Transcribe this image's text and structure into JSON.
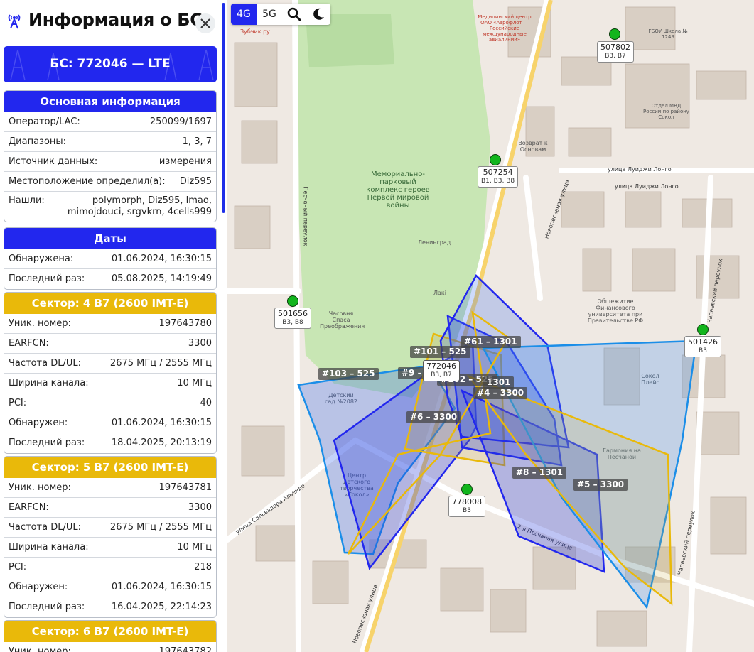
{
  "sidebar": {
    "title": "Информация о БС",
    "bs_banner": "БС: 772046 — LTE",
    "main_info": {
      "header": "Основная информация",
      "rows": [
        {
          "key": "Оператор/LAC:",
          "value": "250099/1697"
        },
        {
          "key": "Диапазоны:",
          "value": "1, 3, 7"
        },
        {
          "key": "Источник данных:",
          "value": "измерения"
        },
        {
          "key": "Местоположение определил(а):",
          "value": "Diz595"
        },
        {
          "key": "Нашли:",
          "value": "polymorph, Diz595, lmao, mimojdouci, srgvkrn, 4cells999"
        }
      ]
    },
    "dates": {
      "header": "Даты",
      "rows": [
        {
          "key": "Обнаружена:",
          "value": "01.06.2024, 16:30:15"
        },
        {
          "key": "Последний раз:",
          "value": "05.08.2025, 14:19:49"
        }
      ]
    },
    "sector4": {
      "header": "Сектор: 4 B7 (2600 IMT-E)",
      "rows": [
        {
          "key": "Уник. номер:",
          "value": "197643780"
        },
        {
          "key": "EARFCN:",
          "value": "3300"
        },
        {
          "key": "Частота DL/UL:",
          "value": "2675 МГц / 2555 МГц"
        },
        {
          "key": "Ширина канала:",
          "value": "10 МГц"
        },
        {
          "key": "PCI:",
          "value": "40"
        },
        {
          "key": "Обнаружен:",
          "value": "01.06.2024, 16:30:15"
        },
        {
          "key": "Последний раз:",
          "value": "18.04.2025, 20:13:19"
        }
      ]
    },
    "sector5": {
      "header": "Сектор: 5 B7 (2600 IMT-E)",
      "rows": [
        {
          "key": "Уник. номер:",
          "value": "197643781"
        },
        {
          "key": "EARFCN:",
          "value": "3300"
        },
        {
          "key": "Частота DL/UL:",
          "value": "2675 МГц / 2555 МГц"
        },
        {
          "key": "Ширина канала:",
          "value": "10 МГц"
        },
        {
          "key": "PCI:",
          "value": "218"
        },
        {
          "key": "Обнаружен:",
          "value": "01.06.2024, 16:30:15"
        },
        {
          "key": "Последний раз:",
          "value": "16.04.2025, 22:14:23"
        }
      ]
    },
    "sector6": {
      "header": "Сектор: 6 B7 (2600 IMT-E)",
      "rows": [
        {
          "key": "Уник. номер:",
          "value": "197643782"
        }
      ]
    }
  },
  "map": {
    "tabs": [
      {
        "label": "4G",
        "active": true
      },
      {
        "label": "5G",
        "active": false
      }
    ],
    "base_stations": [
      {
        "id": "507802",
        "bands": "B3, B7"
      },
      {
        "id": "507254",
        "bands": "B1, B3, B8"
      },
      {
        "id": "501656",
        "bands": "B3, B8"
      },
      {
        "id": "501426",
        "bands": "B3"
      },
      {
        "id": "778008",
        "bands": "B3"
      },
      {
        "id": "772046",
        "bands": "B3, B7"
      }
    ],
    "sector_labels": [
      "#61 – 1301",
      "#101 – 525",
      "#9 – 1301",
      "#102 – 525",
      "1301",
      "#4 – 3300",
      "#103 – 525",
      "#6 – 3300",
      "#8 – 1301",
      "#5 – 3300"
    ],
    "street_names": [
      "улица Луиджи Лонго",
      "улица Луиджи Лонго",
      "Песчаный переулок",
      "Новопесчаная улица",
      "улица Сальвадора Альенде",
      "2-я Песчаная улица",
      "Чапаевский переулок",
      "Чапаевский переулок",
      "Новопесчаная улица"
    ],
    "places": [
      "Мемориально-парковый комплекс героев Первой мировой войны",
      "Общежитие Финансового университета при Правительстве РФ",
      "Медицинский центр ОАО «Аэрофлот — Российские международные авиалинии»",
      "Отдел МВД России по району Сокол",
      "ГБОУ Школа № 1249",
      "Ленинград",
      "Детский сад №2082",
      "Центр детского творчества «Сокол»",
      "Сокол Плейс",
      "Гармония на Песчаной",
      "Лакі",
      "Возврат к Основам",
      "Зубчик.ру",
      "Часовня Спаса Преображения"
    ],
    "colors": {
      "accent_blue": "#2227ee",
      "accent_yellow": "#e9b90a",
      "bs_green": "#12b51d"
    }
  }
}
